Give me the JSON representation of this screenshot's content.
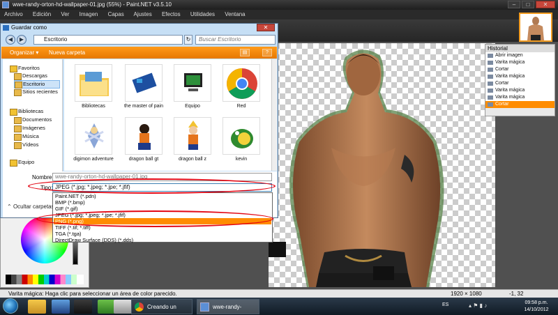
{
  "paintnet": {
    "title": "wwe-randy-orton-hd-wallpaper-01.jpg (55%) - Paint.NET v3.5.10",
    "menu": [
      "Archivo",
      "Edición",
      "Ver",
      "Imagen",
      "Capas",
      "Ajustes",
      "Efectos",
      "Utilidades",
      "Ventana"
    ],
    "window_buttons": [
      "–",
      "□",
      "✕"
    ]
  },
  "history": {
    "title": "Historial",
    "items": [
      "Abrir imagen",
      "Varita mágica",
      "Cortar",
      "Varita mágica",
      "Cortar",
      "Varita mágica",
      "Varita mágica",
      "Cortar"
    ],
    "selected_index": 7
  },
  "status": {
    "text": "Varita mágica: Haga clic para seleccionar un área de color parecido.",
    "size": "1920 × 1080",
    "coords": "-1, 32"
  },
  "dialog": {
    "title": "Guardar como",
    "address": "Escritorio",
    "search_placeholder": "Buscar Escritorio",
    "organize": "Organizar ▾",
    "new_folder": "Nueva carpeta",
    "nav": {
      "favorites": "Favoritos",
      "fav_items": [
        "Descargas",
        "Escritorio",
        "Sitios recientes"
      ],
      "selected": "Escritorio",
      "libraries": "Bibliotecas",
      "lib_items": [
        "Documentos",
        "Imágenes",
        "Música",
        "Vídeos"
      ],
      "computer": "Equipo"
    },
    "files": [
      "Bibliotecas",
      "the master of pain",
      "Equipo",
      "Red",
      "digimon adventure",
      "dragon ball gt",
      "dragon ball z",
      "kevin"
    ],
    "name_label": "Nombre:",
    "name_value": "wwe-randy-orton-hd-wallpaper-01.jpg",
    "type_label": "Tipo:",
    "type_value": "JPEG (*.jpg; *.jpeg; *.jpe; *.jfif)",
    "hide_folders": "Ocultar carpetas",
    "type_options": [
      "Paint.NET (*.pdn)",
      "BMP (*.bmp)",
      "GIF (*.gif)",
      "JPEG (*.jpg; *.jpeg; *.jpe; *.jfif)",
      "PNG (*.png)",
      "TIFF (*.tif; *.tiff)",
      "TGA (*.tga)",
      "DirectDraw Surface (DDS) (*.dds)"
    ],
    "selected_option": "PNG (*.png)"
  },
  "taskbar": {
    "tasks": [
      "Creando un nuev...",
      "wwe-randy-orton..."
    ],
    "lang": "ES",
    "time": "09:58 p.m.",
    "date": "14/10/2012"
  },
  "colors": {
    "accent": "#ff8c00",
    "annotation_ring": "#e30613"
  }
}
